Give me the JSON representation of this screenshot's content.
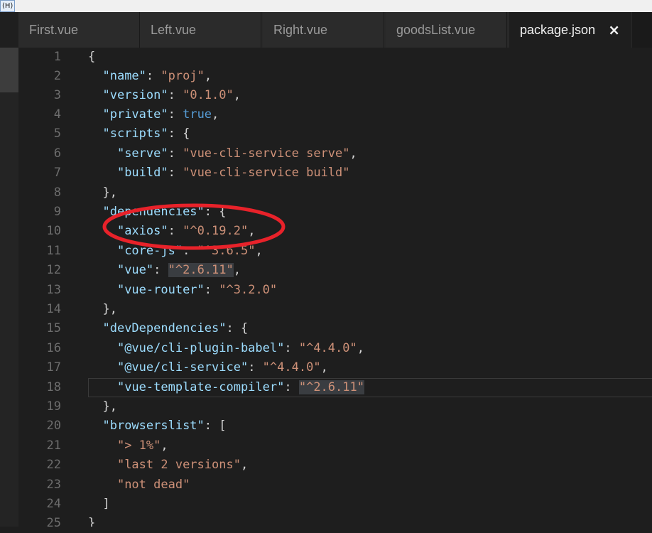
{
  "menubar": {
    "item": "(H)"
  },
  "tabs": [
    {
      "label": "First.vue",
      "active": false
    },
    {
      "label": "Left.vue",
      "active": false
    },
    {
      "label": "Right.vue",
      "active": false
    },
    {
      "label": "goodsList.vue",
      "active": false
    },
    {
      "label": "package.json",
      "active": true
    }
  ],
  "close_glyph": "×",
  "line_numbers": [
    "1",
    "2",
    "3",
    "4",
    "5",
    "6",
    "7",
    "8",
    "9",
    "10",
    "11",
    "12",
    "13",
    "14",
    "15",
    "16",
    "17",
    "18",
    "19",
    "20",
    "21",
    "22",
    "23",
    "24",
    "25"
  ],
  "code": {
    "l1": "{",
    "l2_key": "\"name\"",
    "l2_val": "\"proj\"",
    "l3_key": "\"version\"",
    "l3_val": "\"0.1.0\"",
    "l4_key": "\"private\"",
    "l4_val": "true",
    "l5_key": "\"scripts\"",
    "l6_key": "\"serve\"",
    "l6_val": "\"vue-cli-service serve\"",
    "l7_key": "\"build\"",
    "l7_val": "\"vue-cli-service build\"",
    "l8": "},",
    "l9_key": "\"dependencies\"",
    "l10_key": "\"axios\"",
    "l10_val": "\"^0.19.2\"",
    "l11_key": "\"core-js\"",
    "l11_val": "\"^3.6.5\"",
    "l12_key": "\"vue\"",
    "l12_val": "\"^2.6.11\"",
    "l13_key": "\"vue-router\"",
    "l13_val": "\"^3.2.0\"",
    "l14": "},",
    "l15_key": "\"devDependencies\"",
    "l16_key": "\"@vue/cli-plugin-babel\"",
    "l16_val": "\"^4.4.0\"",
    "l17_key": "\"@vue/cli-service\"",
    "l17_val": "\"^4.4.0\"",
    "l18_key": "\"vue-template-compiler\"",
    "l18_val": "\"^2.6.11\"",
    "l19": "},",
    "l20_key": "\"browserslist\"",
    "l21_val": "\"> 1%\"",
    "l22_val": "\"last 2 versions\"",
    "l23_val": "\"not dead\"",
    "l24": "]",
    "l25": "}"
  },
  "colors": {
    "background": "#1e1e1e",
    "key": "#9cdcfe",
    "string": "#ce9178",
    "boolean": "#569cd6",
    "annotation": "#e8222a"
  }
}
